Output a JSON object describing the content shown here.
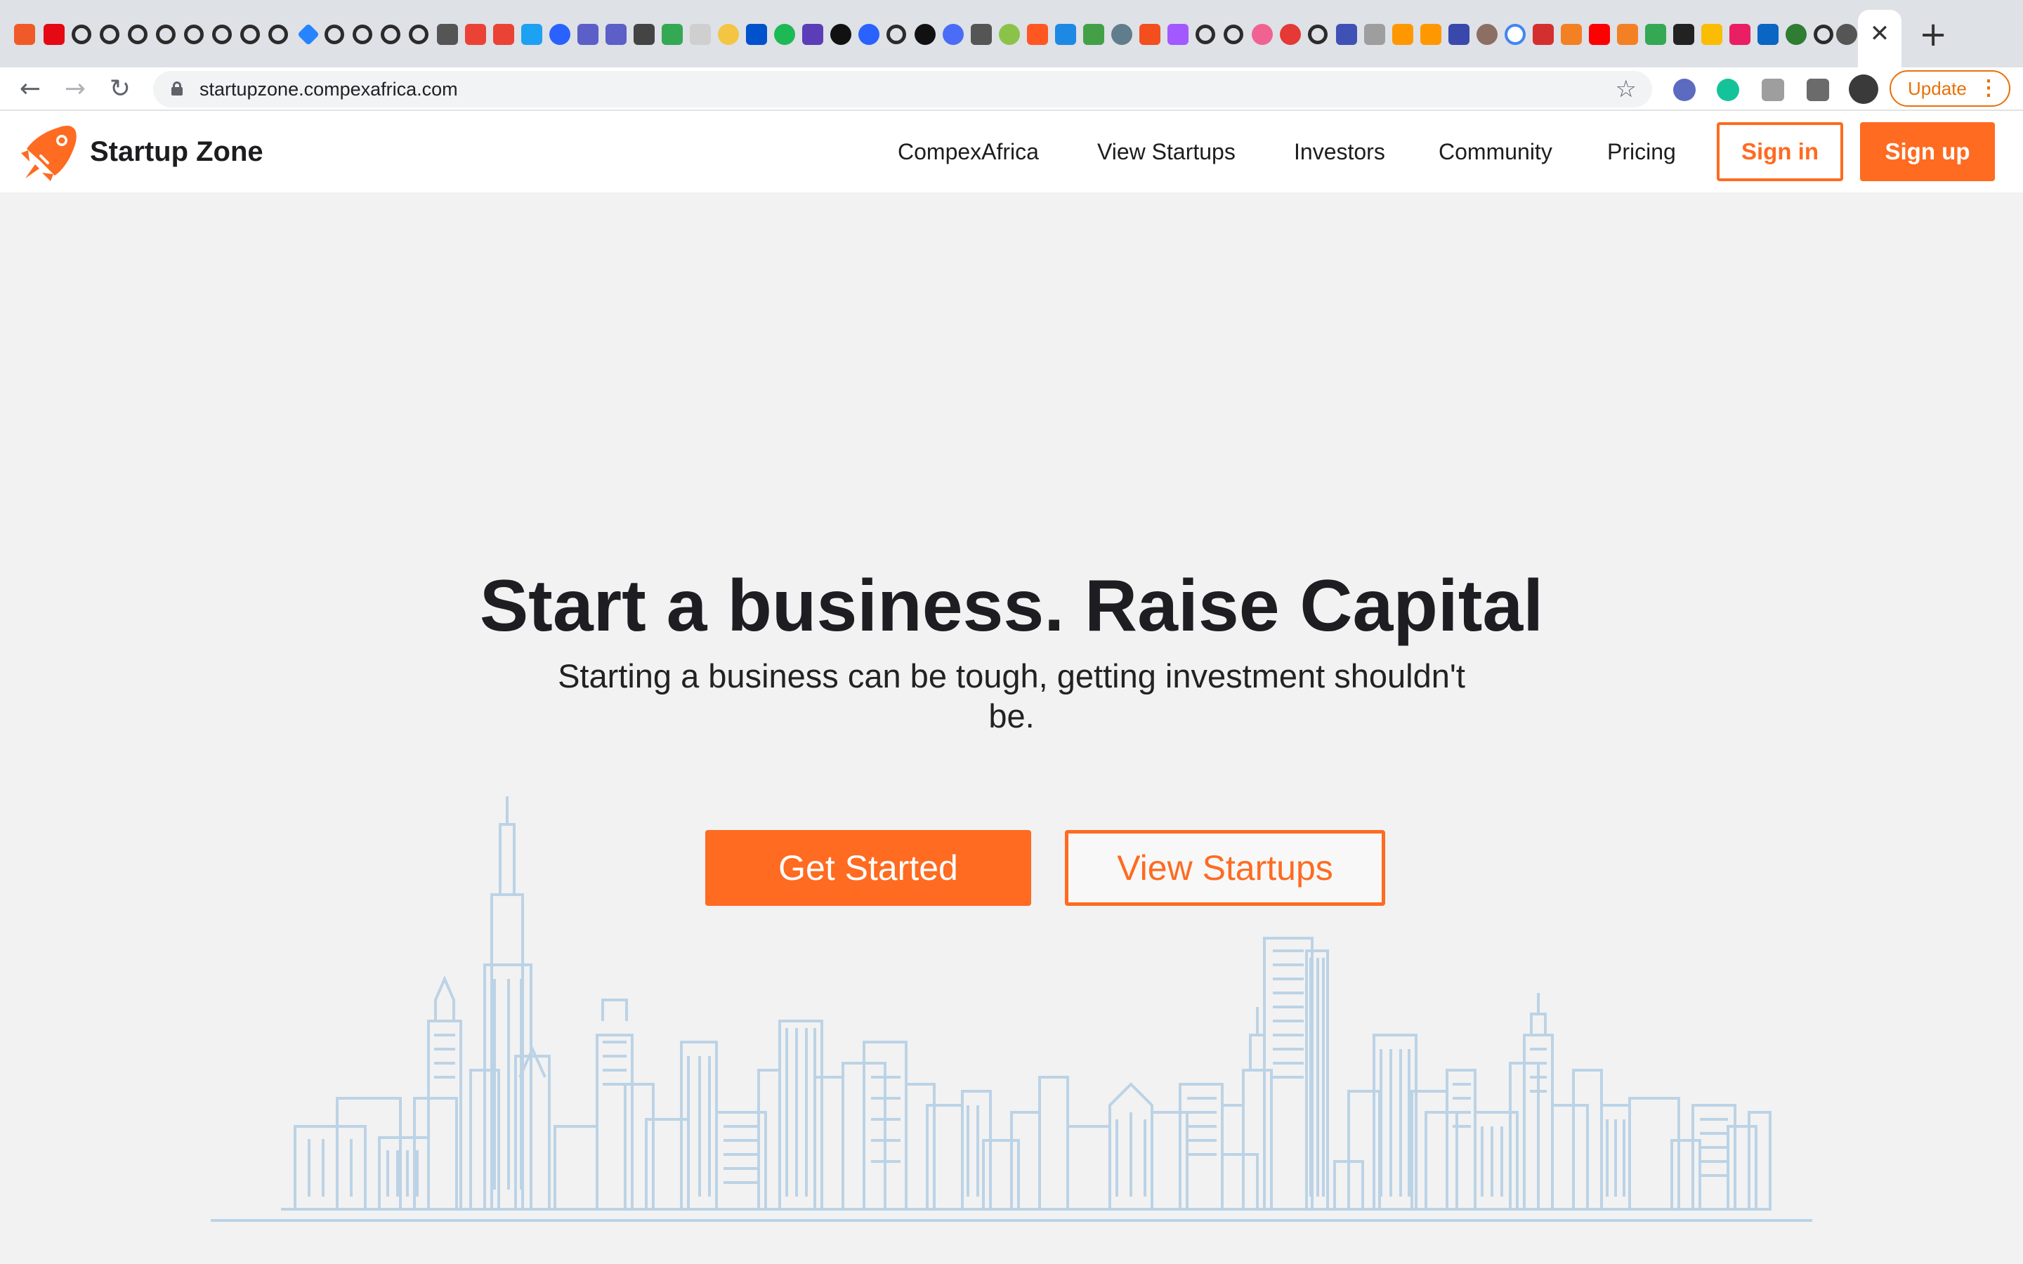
{
  "browser": {
    "url": "startupzone.compexafrica.com",
    "update_label": "Update",
    "tab_close": "✕",
    "new_tab": "+",
    "back": "←",
    "forward": "→",
    "reload": "↻",
    "bookmark": "☆",
    "menu_dots": "⋮"
  },
  "site": {
    "brand": "Startup Zone",
    "nav": [
      "CompexAfrica",
      "View Startups",
      "Investors",
      "Community",
      "Pricing"
    ],
    "sign_in": "Sign in",
    "sign_up": "Sign up"
  },
  "hero": {
    "title": "Start a business. Raise Capital",
    "subtitle": "Starting a business can be tough, getting investment shouldn't be.",
    "primary_cta": "Get Started",
    "secondary_cta": "View Startups"
  },
  "colors": {
    "accent": "#fe6b21",
    "text": "#1d1d22",
    "background": "#f2f2f2",
    "skyline": "#bcd3e6"
  }
}
